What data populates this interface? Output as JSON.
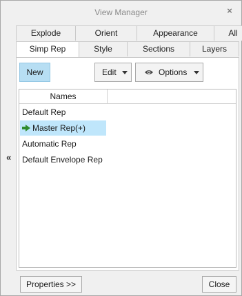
{
  "window": {
    "title": "View Manager",
    "close_glyph": "×",
    "collapse_glyph": "«"
  },
  "tabs": {
    "back_row": [
      "Explode",
      "Orient",
      "Appearance",
      "All"
    ],
    "front_row": [
      "Simp Rep",
      "Style",
      "Sections",
      "Layers"
    ],
    "selected": "Simp Rep"
  },
  "toolbar": {
    "new_label": "New",
    "edit_label": "Edit",
    "options_label": "Options"
  },
  "list": {
    "column_header": "Names",
    "items": [
      {
        "label": "Default Rep",
        "selected": false
      },
      {
        "label": "Master Rep(+)",
        "selected": true,
        "icon": "green-arrow-icon"
      },
      {
        "label": "Automatic Rep",
        "selected": false
      },
      {
        "label": "Default Envelope Rep",
        "selected": false
      }
    ]
  },
  "footer": {
    "properties_label": "Properties >>",
    "close_label": "Close"
  },
  "colors": {
    "new_button_bg": "#b7def3",
    "selection_bg": "#bfe6fb",
    "active_arrow": "#2e8b2e"
  }
}
